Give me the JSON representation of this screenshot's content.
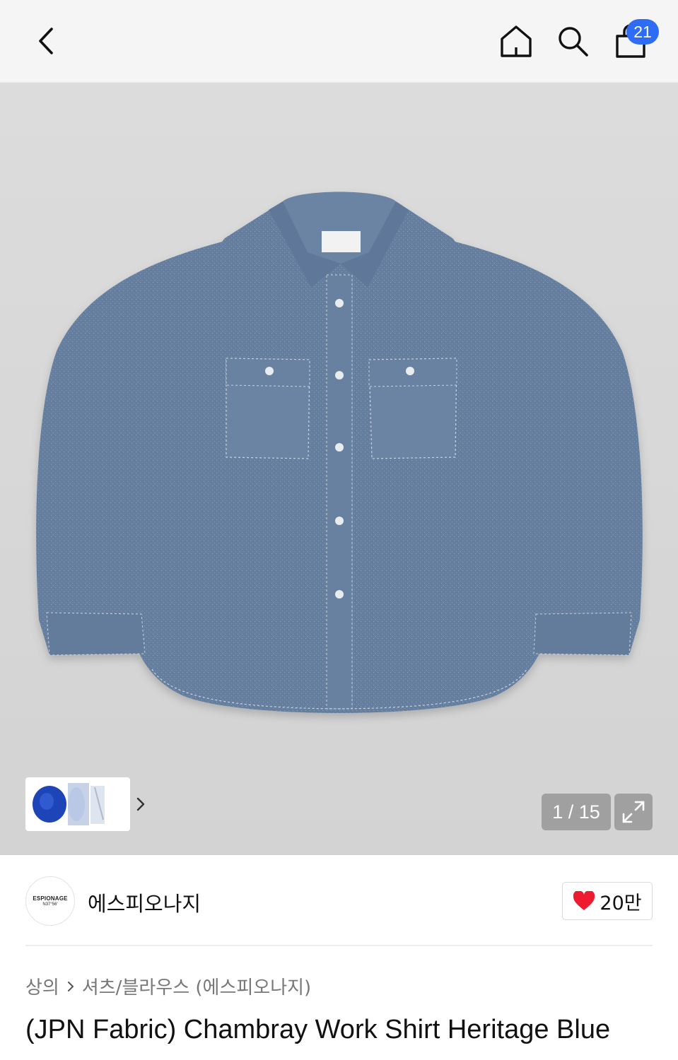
{
  "header": {
    "back_icon": "chevron-left-icon",
    "home_icon": "home-icon",
    "search_icon": "search-icon",
    "cart_icon": "shopping-bag-icon",
    "cart_count": "21",
    "badge_color": "#2f6cf6"
  },
  "gallery": {
    "main_image": "chambray blue work shirt",
    "counter": "1 / 15",
    "expand_icon": "expand-icon",
    "thumbnail_next_icon": "chevron-right-icon"
  },
  "brand": {
    "logo_line1": "ESPIONAGE",
    "logo_line2": "N37°56'",
    "name": "에스피오나지",
    "like_icon": "heart-icon",
    "like_color": "#ee1b2f",
    "like_count": "20만"
  },
  "breadcrumb": {
    "category": "상의",
    "separator_icon": "chevron-right-icon",
    "subcategory": "셔츠/블라우스 (에스피오나지)"
  },
  "product": {
    "title": "(JPN Fabric) Chambray Work Shirt Heritage Blue"
  }
}
